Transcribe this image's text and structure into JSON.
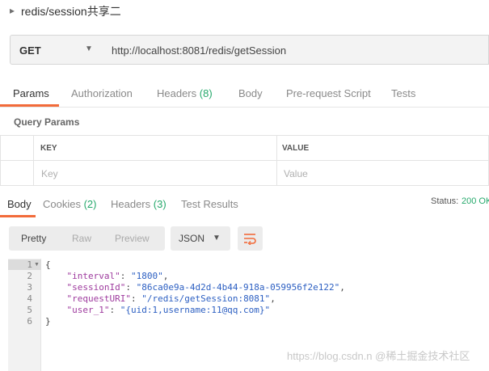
{
  "title": "redis/session共享二",
  "request": {
    "method": "GET",
    "url": "http://localhost:8081/redis/getSession"
  },
  "request_tabs": [
    {
      "label": "Params"
    },
    {
      "label": "Authorization"
    },
    {
      "label": "Headers",
      "count": "(8)"
    },
    {
      "label": "Body"
    },
    {
      "label": "Pre-request Script"
    },
    {
      "label": "Tests"
    }
  ],
  "query_params": {
    "label": "Query Params",
    "headers": [
      "KEY",
      "VALUE"
    ],
    "placeholders": [
      "Key",
      "Value"
    ]
  },
  "response_tabs": [
    {
      "label": "Body"
    },
    {
      "label": "Cookies",
      "count": "(2)"
    },
    {
      "label": "Headers",
      "count": "(3)"
    },
    {
      "label": "Test Results"
    }
  ],
  "status": {
    "label": "Status:",
    "value": "200 OK"
  },
  "view_modes": [
    "Pretty",
    "Raw",
    "Preview"
  ],
  "format": "JSON",
  "code": {
    "line_numbers": [
      "1",
      "2",
      "3",
      "4",
      "5",
      "6"
    ],
    "open": "{",
    "close": "}",
    "fields": [
      {
        "key": "\"interval\"",
        "value": "\"1800\"",
        "trail": ","
      },
      {
        "key": "\"sessionId\"",
        "value": "\"86ca0e9a-4d2d-4b44-918a-059956f2e122\"",
        "trail": ","
      },
      {
        "key": "\"requestURI\"",
        "value": "\"/redis/getSession:8081\"",
        "trail": ","
      },
      {
        "key": "\"user_1\"",
        "value": "\"{uid:1,username:11@qq.com}\"",
        "trail": ""
      }
    ]
  },
  "watermark": "https://blog.csdn.n @稀土掘金技术社区",
  "colors": {
    "accent": "#f26b3a",
    "status_ok": "#26a96c"
  }
}
